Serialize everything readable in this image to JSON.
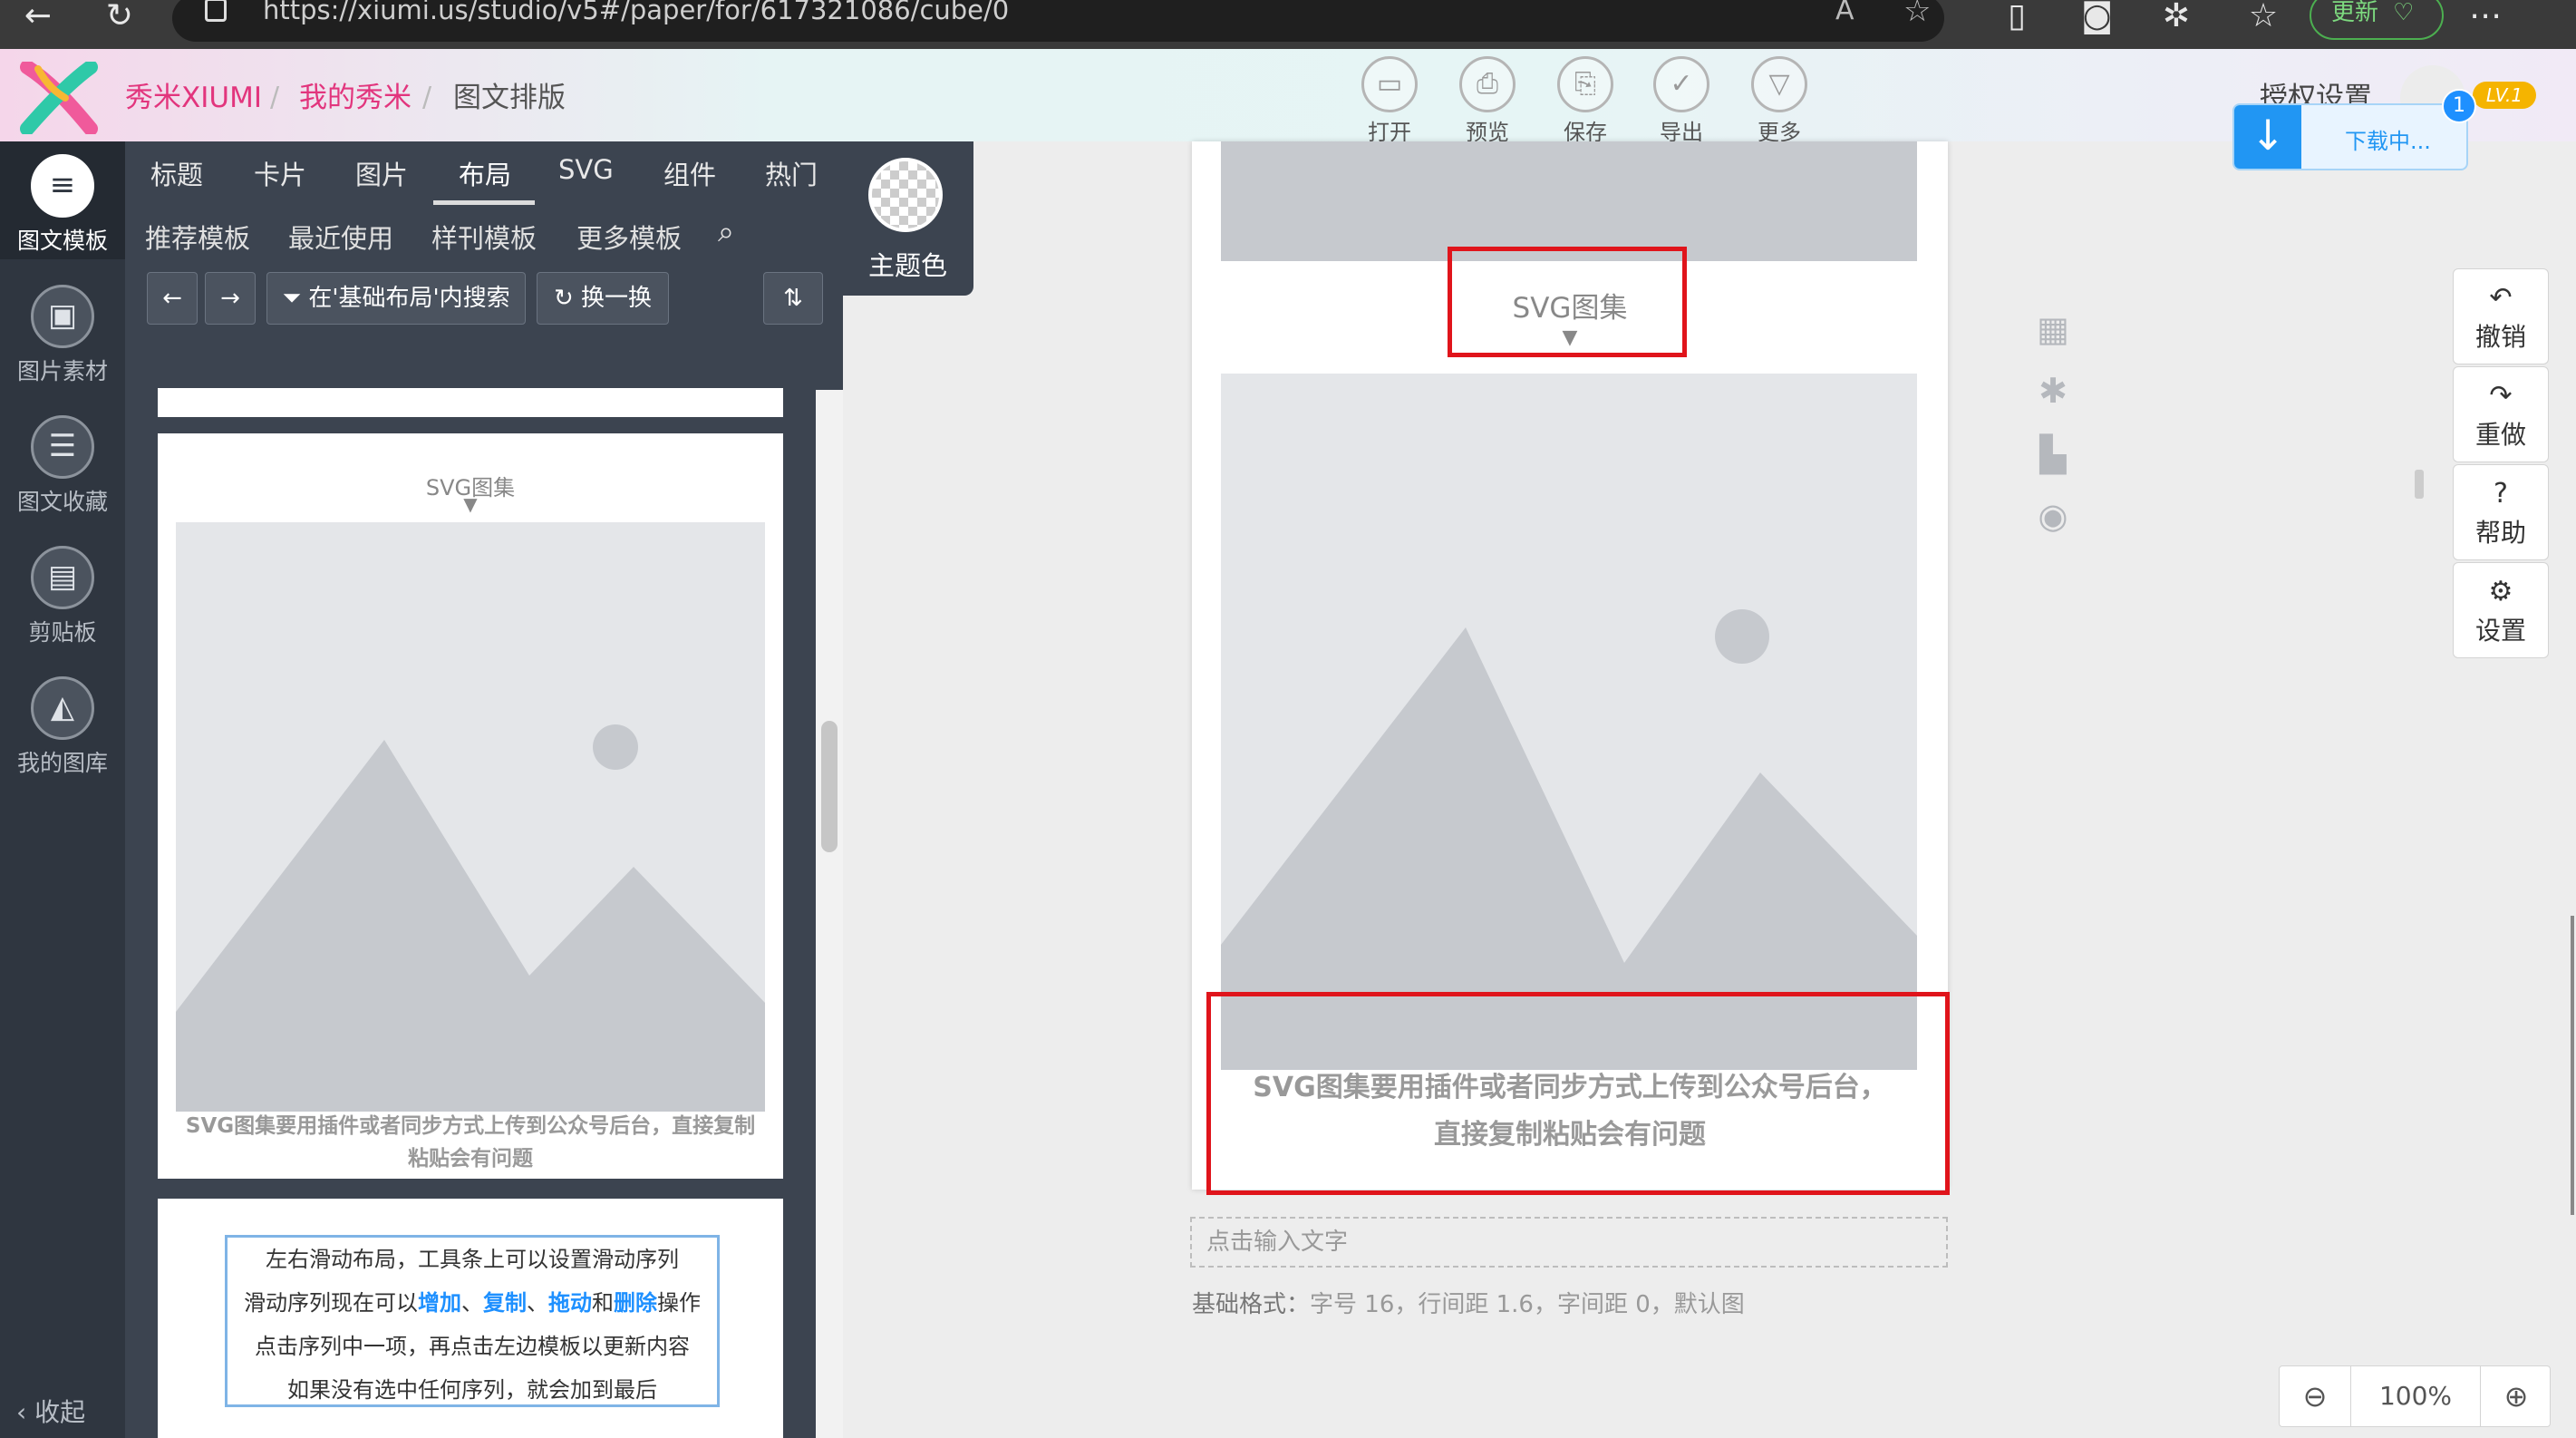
{
  "browser": {
    "url": "https://xiumi.us/studio/v5#/paper/for/617321086/cube/0",
    "update_label": "更新"
  },
  "header": {
    "brand": "秀米XIUMI",
    "breadcrumb_mine": "我的秀米",
    "breadcrumb_current": "图文排版",
    "tools": [
      {
        "label": "打开",
        "icon": "folder-icon"
      },
      {
        "label": "预览",
        "icon": "preview-icon"
      },
      {
        "label": "保存",
        "icon": "save-icon"
      },
      {
        "label": "导出",
        "icon": "check-icon"
      },
      {
        "label": "更多",
        "icon": "more-icon"
      }
    ],
    "auth_label": "授权设置",
    "level": "LV.1",
    "download_text": "下载中...",
    "download_count": "1"
  },
  "rail": {
    "items": [
      "图文模板",
      "图片素材",
      "图文收藏",
      "剪贴板",
      "我的图库"
    ],
    "collapse": "收起"
  },
  "panel": {
    "tabs": [
      "标题",
      "卡片",
      "图片",
      "布局",
      "SVG",
      "组件",
      "热门"
    ],
    "active_tab": "布局",
    "subtabs": [
      "推荐模板",
      "最近使用",
      "样刊模板",
      "更多模板"
    ],
    "theme_label": "主题色",
    "search_scope": "在'基础布局'内搜索",
    "shuffle": "换一换",
    "card1": {
      "title": "SVG图集",
      "caption": "SVG图集要用插件或者同步方式上传到公众号后台，直接复制粘贴会有问题"
    },
    "card2": {
      "line1": "左右滑动布局，工具条上可以设置滑动序列",
      "line2_pre": "滑动序列现在可以",
      "add": "增加",
      "sep1": "、",
      "copy": "复制",
      "sep2": "、",
      "drag": "拖动",
      "and": "和",
      "delete": "删除",
      "line2_post": "操作",
      "line3": "点击序列中一项，再点击左边模板以更新内容",
      "line4": "如果没有选中任何序列，就会加到最后"
    }
  },
  "canvas": {
    "gallery_title": "SVG图集",
    "caption_line1": "SVG图集要用插件或者同步方式上传到公众号后台，",
    "caption_line2": "直接复制粘贴会有问题",
    "text_placeholder": "点击输入文字",
    "format_label": "基础格式：",
    "format_value": "字号 16，行间距 1.6，字间距 0，默认图"
  },
  "right_tools": [
    {
      "label": "撤销",
      "icon": "undo-icon"
    },
    {
      "label": "重做",
      "icon": "redo-icon"
    },
    {
      "label": "帮助",
      "icon": "help-icon"
    },
    {
      "label": "设置",
      "icon": "settings-icon"
    }
  ],
  "zoom": {
    "value": "100%"
  }
}
